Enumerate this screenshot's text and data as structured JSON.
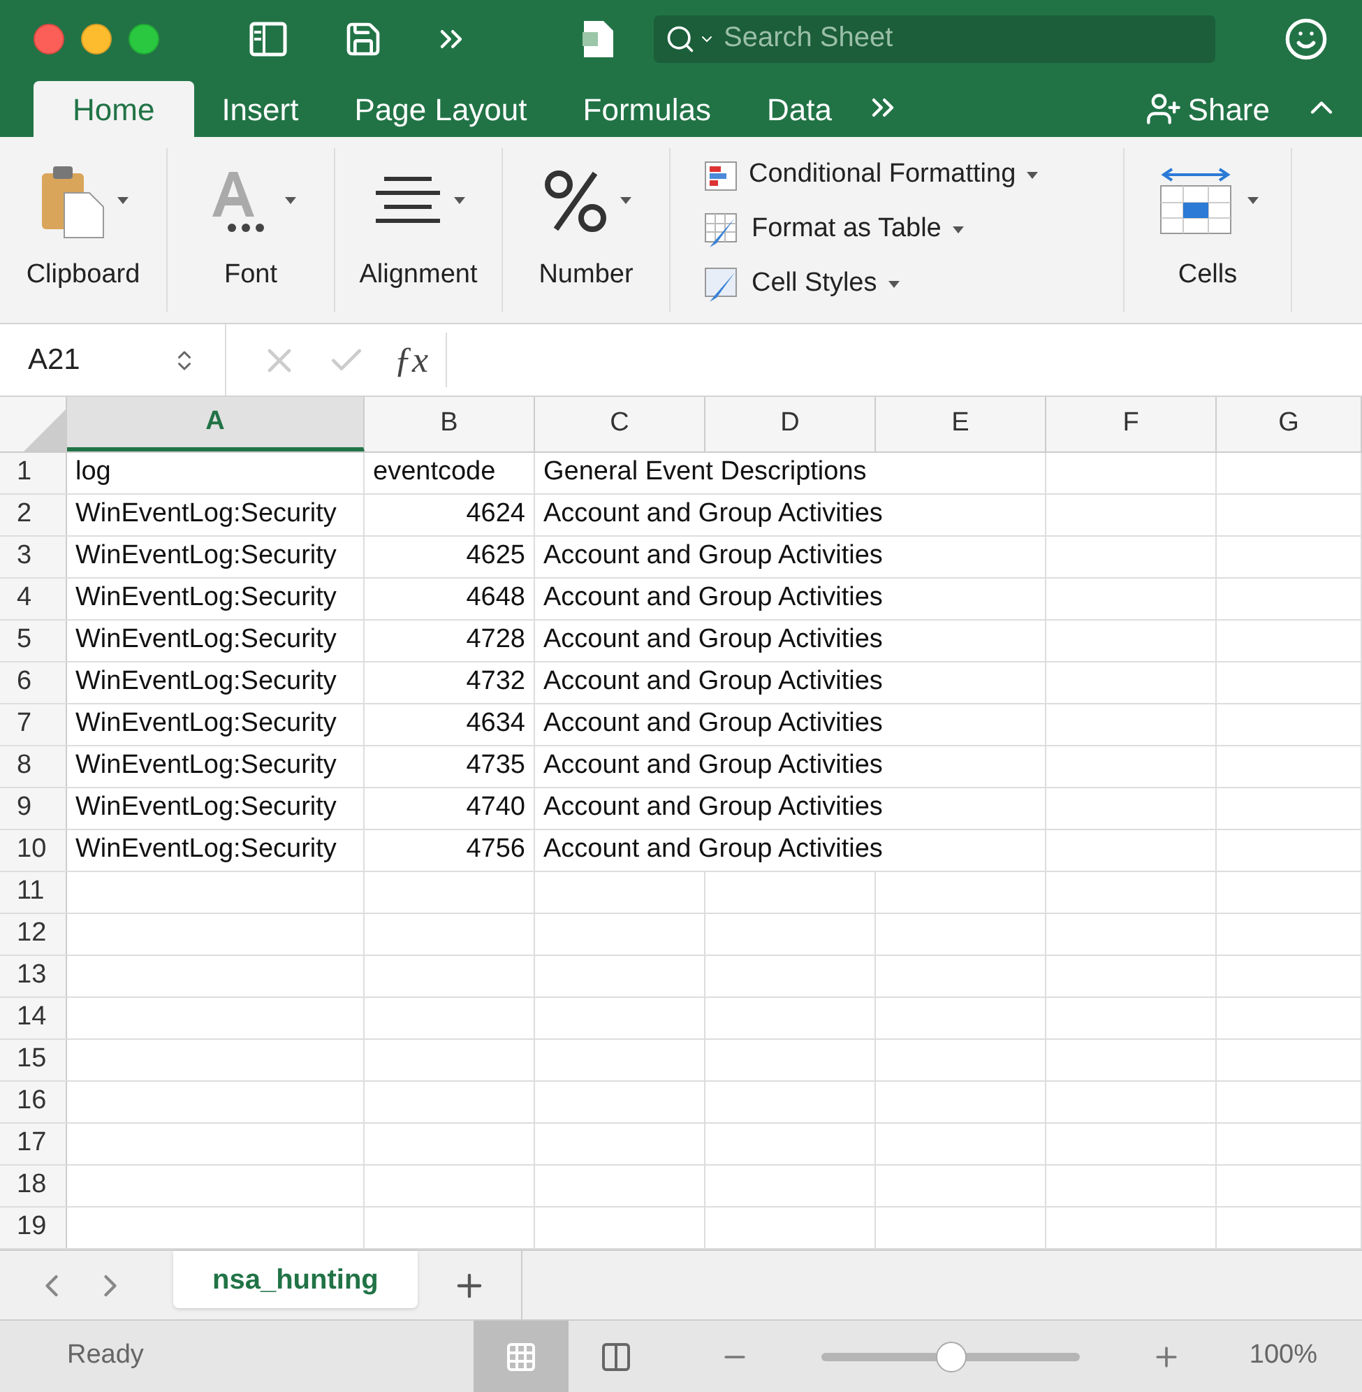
{
  "title_bar": {
    "search": {
      "placeholder": "Search Sheet"
    }
  },
  "ribbon_tabs": [
    {
      "label": "Home",
      "selected": true
    },
    {
      "label": "Insert",
      "selected": false
    },
    {
      "label": "Page Layout",
      "selected": false
    },
    {
      "label": "Formulas",
      "selected": false
    },
    {
      "label": "Data",
      "selected": false
    }
  ],
  "share": {
    "label": "Share"
  },
  "ribbon_groups": [
    {
      "kind": "clipboard",
      "label": "Clipboard"
    },
    {
      "kind": "font",
      "label": "Font"
    },
    {
      "kind": "alignment",
      "label": "Alignment"
    },
    {
      "kind": "number",
      "label": "Number"
    },
    {
      "kind": "styles",
      "items": [
        {
          "kind": "conditional",
          "label": "Conditional Formatting"
        },
        {
          "kind": "table",
          "label": "Format as Table"
        },
        {
          "kind": "cell",
          "label": "Cell Styles"
        }
      ]
    },
    {
      "kind": "cells",
      "label": "Cells"
    }
  ],
  "formula_bar": {
    "name_box": "A21",
    "function_label": "ƒx"
  },
  "columns": [
    {
      "label": "A",
      "selected": true
    },
    {
      "label": "B",
      "selected": false
    },
    {
      "label": "C",
      "selected": false
    },
    {
      "label": "D",
      "selected": false
    },
    {
      "label": "E",
      "selected": false
    },
    {
      "label": "F",
      "selected": false
    },
    {
      "label": "G",
      "selected": false
    }
  ],
  "rows": [
    {
      "number": "1",
      "cells": [
        {
          "text": "log",
          "kind": "text"
        },
        {
          "text": "eventcode",
          "kind": "text"
        },
        {
          "text": "General Event Descriptions",
          "kind": "text"
        }
      ]
    },
    {
      "number": "2",
      "cells": [
        {
          "text": "WinEventLog:Security",
          "kind": "text"
        },
        {
          "text": "4624",
          "kind": "number"
        },
        {
          "text": "Account and Group Activities",
          "kind": "text"
        }
      ]
    },
    {
      "number": "3",
      "cells": [
        {
          "text": "WinEventLog:Security",
          "kind": "text"
        },
        {
          "text": "4625",
          "kind": "number"
        },
        {
          "text": "Account and Group Activities",
          "kind": "text"
        }
      ]
    },
    {
      "number": "4",
      "cells": [
        {
          "text": "WinEventLog:Security",
          "kind": "text"
        },
        {
          "text": "4648",
          "kind": "number"
        },
        {
          "text": "Account and Group Activities",
          "kind": "text"
        }
      ]
    },
    {
      "number": "5",
      "cells": [
        {
          "text": "WinEventLog:Security",
          "kind": "text"
        },
        {
          "text": "4728",
          "kind": "number"
        },
        {
          "text": "Account and Group Activities",
          "kind": "text"
        }
      ]
    },
    {
      "number": "6",
      "cells": [
        {
          "text": "WinEventLog:Security",
          "kind": "text"
        },
        {
          "text": "4732",
          "kind": "number"
        },
        {
          "text": "Account and Group Activities",
          "kind": "text"
        }
      ]
    },
    {
      "number": "7",
      "cells": [
        {
          "text": "WinEventLog:Security",
          "kind": "text"
        },
        {
          "text": "4634",
          "kind": "number"
        },
        {
          "text": "Account and Group Activities",
          "kind": "text"
        }
      ]
    },
    {
      "number": "8",
      "cells": [
        {
          "text": "WinEventLog:Security",
          "kind": "text"
        },
        {
          "text": "4735",
          "kind": "number"
        },
        {
          "text": "Account and Group Activities",
          "kind": "text"
        }
      ]
    },
    {
      "number": "9",
      "cells": [
        {
          "text": "WinEventLog:Security",
          "kind": "text"
        },
        {
          "text": "4740",
          "kind": "number"
        },
        {
          "text": "Account and Group Activities",
          "kind": "text"
        }
      ]
    },
    {
      "number": "10",
      "cells": [
        {
          "text": "WinEventLog:Security",
          "kind": "text"
        },
        {
          "text": "4756",
          "kind": "number"
        },
        {
          "text": "Account and Group Activities",
          "kind": "text"
        }
      ]
    },
    {
      "number": "11",
      "cells": []
    },
    {
      "number": "12",
      "cells": []
    },
    {
      "number": "13",
      "cells": []
    },
    {
      "number": "14",
      "cells": []
    },
    {
      "number": "15",
      "cells": []
    },
    {
      "number": "16",
      "cells": []
    },
    {
      "number": "17",
      "cells": []
    },
    {
      "number": "18",
      "cells": []
    },
    {
      "number": "19",
      "cells": []
    }
  ],
  "sheet_tabs": [
    {
      "label": "nsa_hunting",
      "selected": true
    }
  ],
  "status_bar": {
    "status": "Ready",
    "views": [
      {
        "kind": "normal",
        "selected": true
      },
      {
        "kind": "page_layout",
        "selected": false
      }
    ],
    "zoom": {
      "level": 0.5,
      "reading": "100%"
    }
  }
}
